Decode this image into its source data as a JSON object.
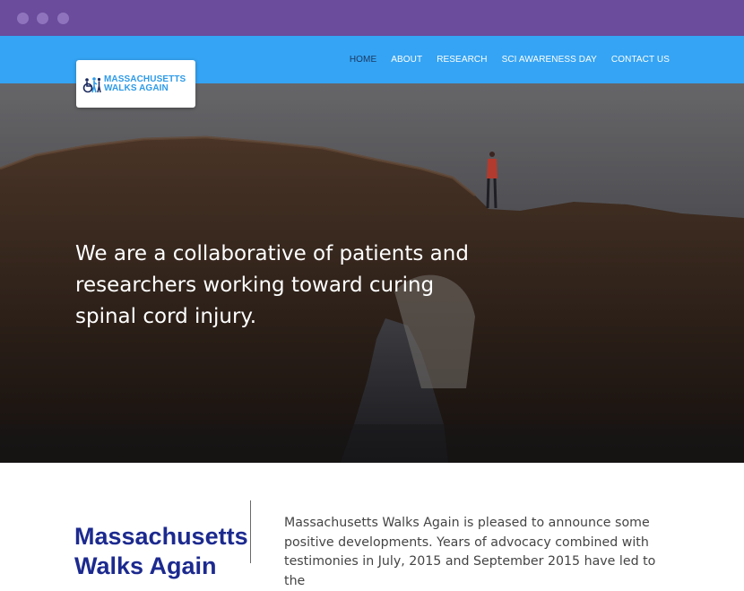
{
  "logo": {
    "line1": "MASSACHUSETTS",
    "line2": "WALKS AGAIN",
    "icon": "people-walking-wheelchair-logo"
  },
  "nav": {
    "items": [
      {
        "label": "HOME",
        "active": true
      },
      {
        "label": "ABOUT",
        "active": false
      },
      {
        "label": "RESEARCH",
        "active": false
      },
      {
        "label": "SCI AWARENESS DAY",
        "active": false
      },
      {
        "label": "CONTACT US",
        "active": false
      }
    ]
  },
  "hero": {
    "heading": "We are a collaborative of patients and researchers working toward curing spinal cord injury."
  },
  "content": {
    "title": "Massachusetts Walks Again",
    "body": "Massachusetts Walks Again is pleased to announce some positive developments. Years of advocacy combined with testimonies in July, 2015 and September 2015 have led to the"
  },
  "colors": {
    "titlebar": "#6a4b9c",
    "navbar": "#35a4f4",
    "brand_blue": "#2e9be8",
    "title_navy": "#1c2a8f"
  }
}
